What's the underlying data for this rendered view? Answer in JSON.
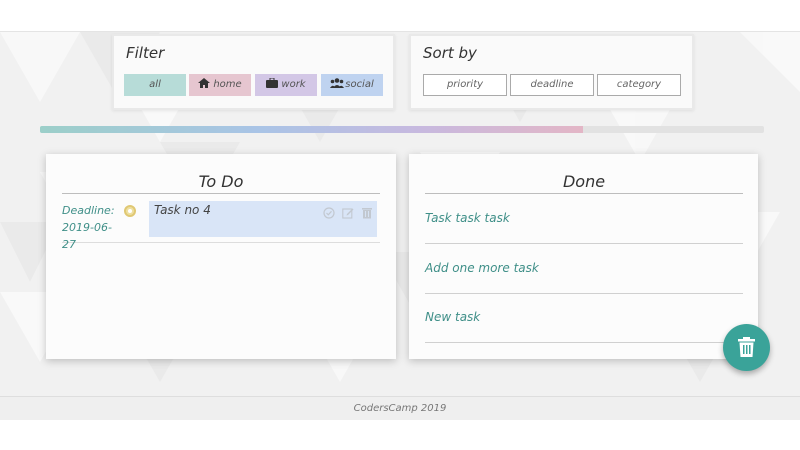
{
  "filter": {
    "title": "Filter",
    "buttons": [
      {
        "label": "all",
        "color": "#b7dcd8",
        "icon": ""
      },
      {
        "label": "home",
        "color": "#e6c6d0",
        "icon": "home-icon"
      },
      {
        "label": "work",
        "color": "#d3c7e6",
        "icon": "briefcase-icon"
      },
      {
        "label": "social",
        "color": "#bfd3f0",
        "icon": "users-icon"
      }
    ]
  },
  "sort": {
    "title": "Sort by",
    "buttons": [
      {
        "label": "priority"
      },
      {
        "label": "deadline"
      },
      {
        "label": "category"
      }
    ]
  },
  "progress": {
    "fraction": 0.75
  },
  "todo": {
    "title": "To Do",
    "tasks": [
      {
        "deadline_label": "Deadline:",
        "deadline": "2019-06-27",
        "text": "Task no 4",
        "priority_color": "#eedfa0"
      }
    ]
  },
  "done": {
    "title": "Done",
    "tasks": [
      {
        "text": "Task task task"
      },
      {
        "text": "Add one more task"
      },
      {
        "text": "New task"
      }
    ]
  },
  "footer": {
    "text": "CodersCamp 2019"
  },
  "colors": {
    "accent": "#3aa399",
    "text_teal": "#3f8f88"
  }
}
